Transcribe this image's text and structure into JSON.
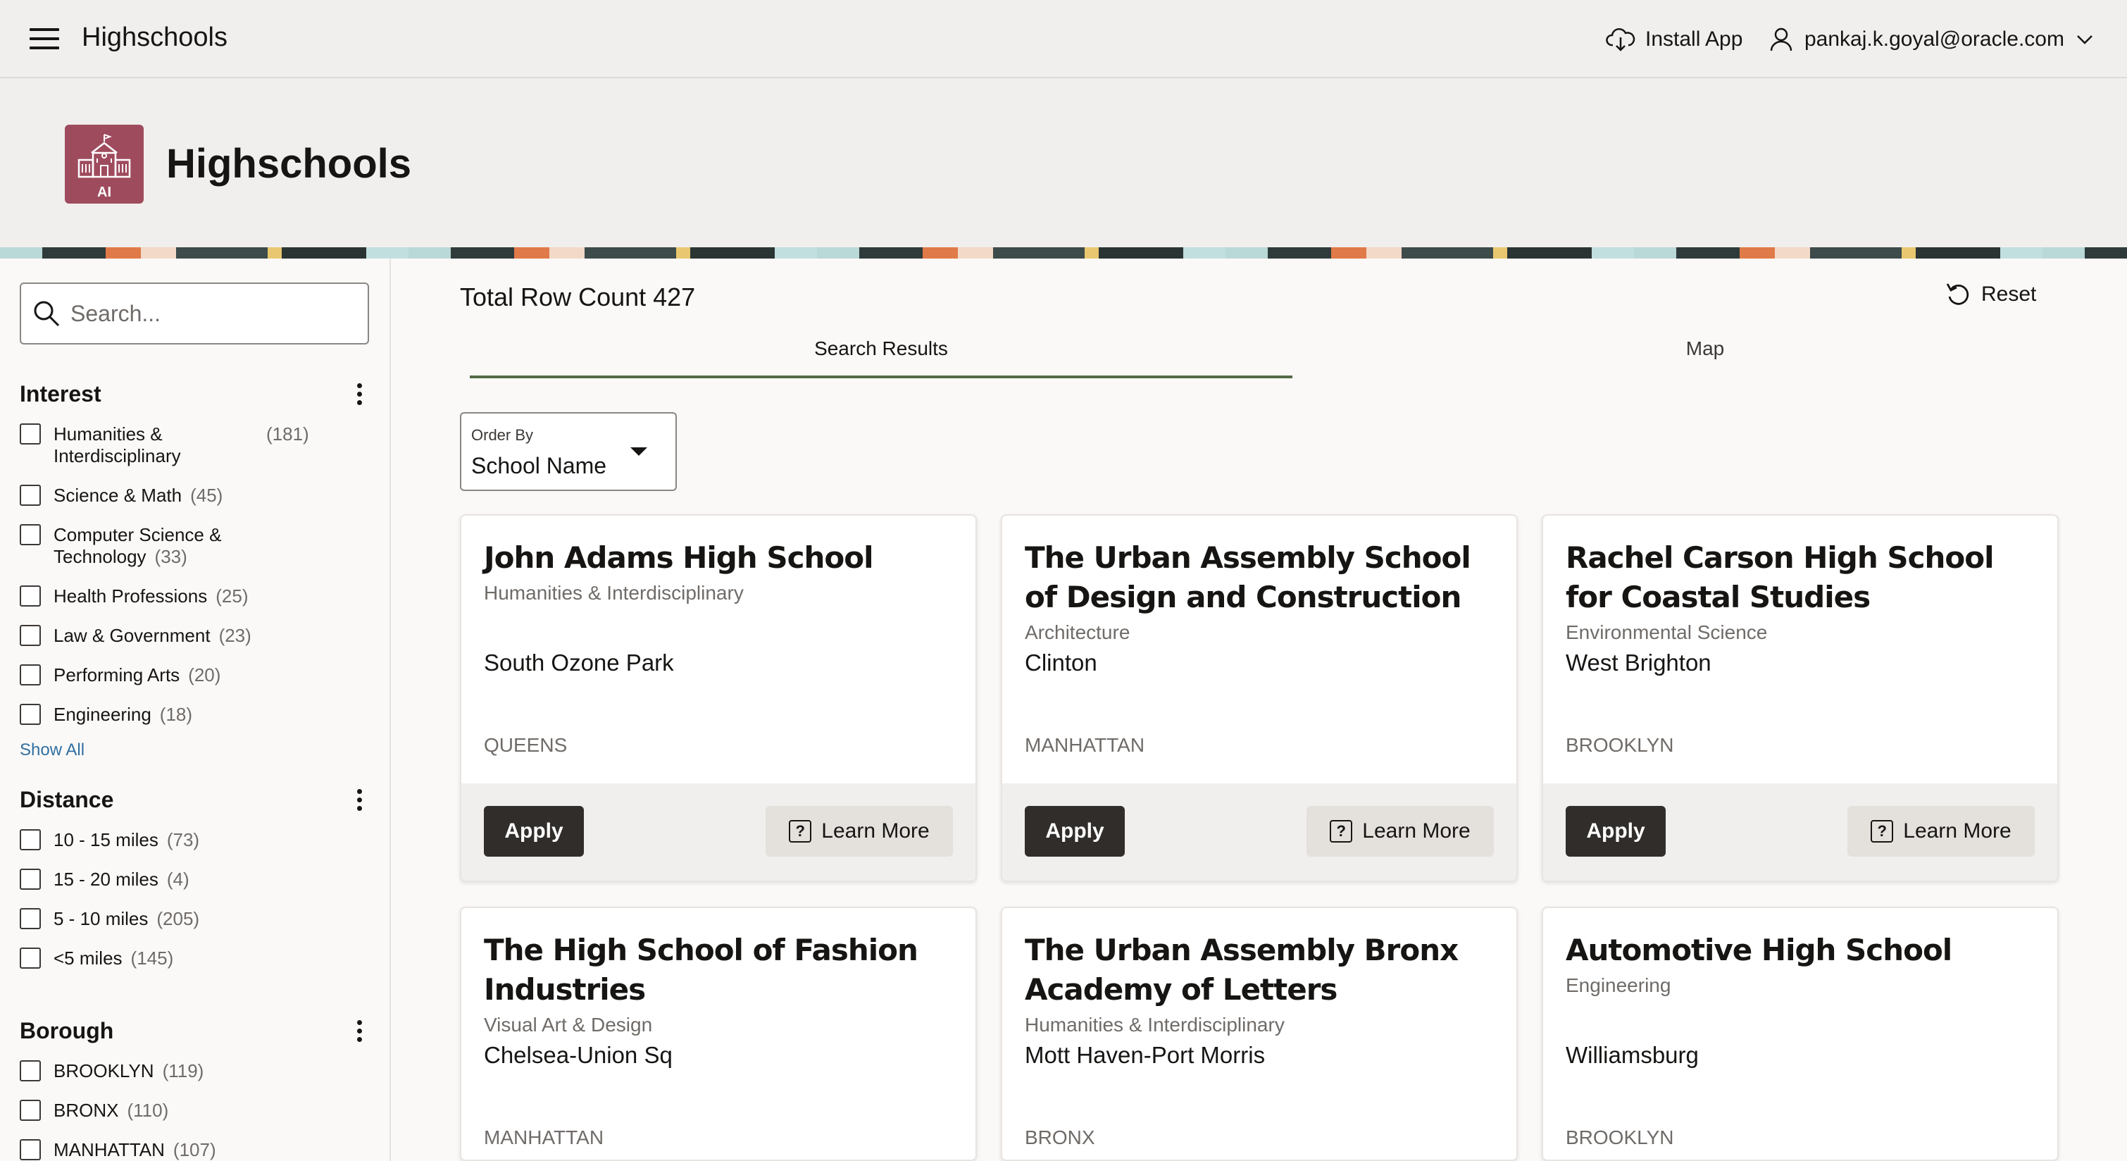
{
  "topbar": {
    "app_name": "Highschools",
    "install_label": "Install App",
    "user_email": "pankaj.k.goyal@oracle.com",
    "icons": [
      "menu-icon",
      "cloud-download-icon",
      "user-icon",
      "chevron-down-icon"
    ]
  },
  "hero": {
    "title": "Highschools",
    "icon_badge": "AI",
    "icon_color": "#9f4b5e"
  },
  "search": {
    "placeholder": "Search..."
  },
  "facets": {
    "interest": {
      "title": "Interest",
      "items": [
        {
          "label": "Humanities & Interdisciplinary",
          "count": "(181)"
        },
        {
          "label": "Science & Math",
          "count": "(45)"
        },
        {
          "label": "Computer Science & Technology",
          "count": "(33)"
        },
        {
          "label": "Health Professions",
          "count": "(25)"
        },
        {
          "label": "Law & Government",
          "count": "(23)"
        },
        {
          "label": "Performing Arts",
          "count": "(20)"
        },
        {
          "label": "Engineering",
          "count": "(18)"
        }
      ],
      "show_all": "Show All"
    },
    "distance": {
      "title": "Distance",
      "items": [
        {
          "label": "10 - 15 miles",
          "count": "(73)"
        },
        {
          "label": "15 - 20 miles",
          "count": "(4)"
        },
        {
          "label": "5 - 10 miles",
          "count": "(205)"
        },
        {
          "label": "<5 miles",
          "count": "(145)"
        }
      ]
    },
    "borough": {
      "title": "Borough",
      "items": [
        {
          "label": "BROOKLYN",
          "count": "(119)"
        },
        {
          "label": "BRONX",
          "count": "(110)"
        },
        {
          "label": "MANHATTAN",
          "count": "(107)"
        }
      ]
    }
  },
  "main": {
    "row_count": "Total Row Count 427",
    "reset_label": "Reset",
    "tabs": [
      {
        "label": "Search Results",
        "active": true
      },
      {
        "label": "Map",
        "active": false
      }
    ],
    "order_by": {
      "label": "Order By",
      "value": "School Name"
    },
    "apply_label": "Apply",
    "learn_more_label": "Learn More",
    "help_glyph": "?"
  },
  "cards": [
    {
      "name": "John Adams High School",
      "interest": "Humanities & Interdisciplinary",
      "neighborhood": "South Ozone Park",
      "borough": "QUEENS"
    },
    {
      "name": "The Urban Assembly School of Design and Construction",
      "interest": "Architecture",
      "neighborhood": "Clinton",
      "borough": "MANHATTAN"
    },
    {
      "name": "Rachel Carson High School for Coastal Studies",
      "interest": "Environmental Science",
      "neighborhood": "West Brighton",
      "borough": "BROOKLYN"
    },
    {
      "name": "The High School of Fashion Industries",
      "interest": "Visual Art & Design",
      "neighborhood": "Chelsea-Union Sq",
      "borough": "MANHATTAN"
    },
    {
      "name": "The Urban Assembly Bronx Academy of Letters",
      "interest": "Humanities & Interdisciplinary",
      "neighborhood": "Mott Haven-Port Morris",
      "borough": "BRONX"
    },
    {
      "name": "Automotive High School",
      "interest": "Engineering",
      "neighborhood": "Williamsburg",
      "borough": "BROOKLYN"
    }
  ],
  "colors": {
    "primary_button": "#312d2a",
    "secondary_button": "#e4e1dd",
    "active_tab": "#556b47",
    "link": "#2f6fa1"
  }
}
